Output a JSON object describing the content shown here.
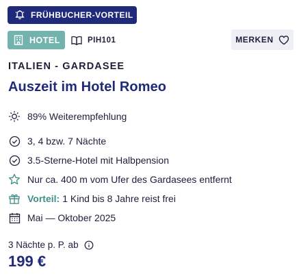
{
  "badges": {
    "early_booking": {
      "label": "FRÜHBUCHER-VORTEIL",
      "icon": "bell-icon"
    },
    "type": {
      "label": "HOTEL",
      "icon": "building-icon"
    },
    "code": {
      "label": "PIH101",
      "icon": "book-icon"
    }
  },
  "actions": {
    "merken_label": "MERKEN",
    "merken_icon": "heart-icon"
  },
  "offer": {
    "region": "ITALIEN - GARDASEE",
    "title": "Auszeit im Hotel Romeo"
  },
  "features": [
    {
      "icon": "sun-icon",
      "text": "89% Weiterempfehlung"
    },
    {
      "icon": "check-circle-icon",
      "text": "3, 4 bzw. 7 Nächte"
    },
    {
      "icon": "check-circle-icon",
      "text": "3.5-Sterne-Hotel mit Halbpension"
    },
    {
      "icon": "star-icon",
      "text": "Nur ca. 400 m vom Ufer des Gardasees entfernt"
    },
    {
      "icon": "gift-icon",
      "highlight": "Vorteil:",
      "text": "1 Kind bis 8 Jahre reist frei"
    },
    {
      "icon": "calendar-icon",
      "text": "Mai — Oktober 2025"
    }
  ],
  "price": {
    "label": "3 Nächte p. P. ab",
    "info_icon": "info-icon",
    "value": "199 €"
  },
  "colors": {
    "navy": "#1f2a7a",
    "teal": "#72b3ad",
    "text": "#1e1e3c",
    "light_bg": "#eef0f6",
    "highlight": "#3f8f88"
  }
}
